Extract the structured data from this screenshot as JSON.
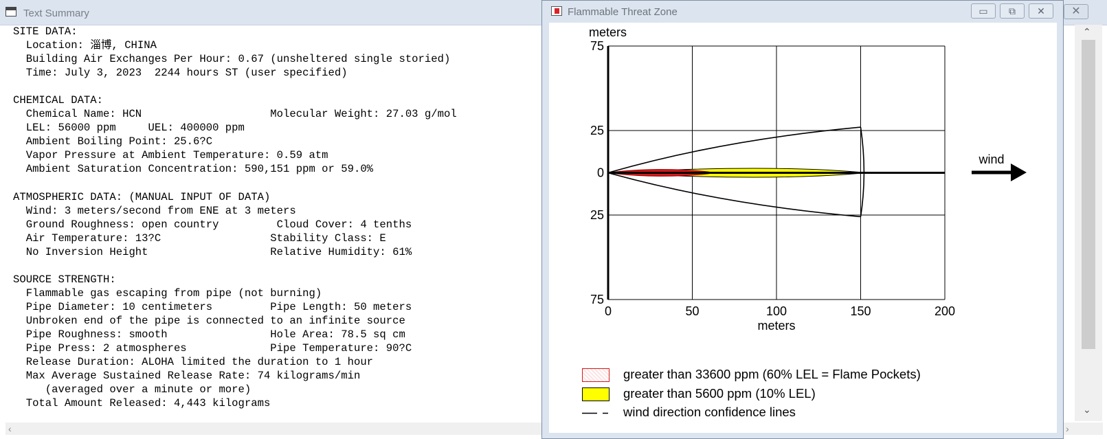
{
  "text_window": {
    "title": "Text Summary",
    "close_glyph": "✕",
    "lines": [
      "SITE DATA:",
      "  Location: 淄博, CHINA",
      "  Building Air Exchanges Per Hour: 0.67 (unsheltered single storied)",
      "  Time: July 3, 2023  2244 hours ST (user specified)",
      "",
      "CHEMICAL DATA:",
      "  Chemical Name: HCN                    Molecular Weight: 27.03 g/mol",
      "  LEL: 56000 ppm     UEL: 400000 ppm",
      "  Ambient Boiling Point: 25.6?C",
      "  Vapor Pressure at Ambient Temperature: 0.59 atm",
      "  Ambient Saturation Concentration: 590,151 ppm or 59.0%",
      "",
      "ATMOSPHERIC DATA: (MANUAL INPUT OF DATA)",
      "  Wind: 3 meters/second from ENE at 3 meters",
      "  Ground Roughness: open country         Cloud Cover: 4 tenths",
      "  Air Temperature: 13?C                 Stability Class: E",
      "  No Inversion Height                   Relative Humidity: 61%",
      "",
      "SOURCE STRENGTH:",
      "  Flammable gas escaping from pipe (not burning)",
      "  Pipe Diameter: 10 centimeters         Pipe Length: 50 meters",
      "  Unbroken end of the pipe is connected to an infinite source",
      "  Pipe Roughness: smooth                Hole Area: 78.5 sq cm",
      "  Pipe Press: 2 atmospheres             Pipe Temperature: 90?C",
      "  Release Duration: ALOHA limited the duration to 1 hour",
      "  Max Average Sustained Release Rate: 74 kilograms/min",
      "     (averaged over a minute or more)",
      "  Total Amount Released: 4,443 kilograms"
    ]
  },
  "threat_window": {
    "title": "Flammable Threat Zone",
    "buttons": {
      "minimize": "▭",
      "maximize": "⧉",
      "close": "✕"
    },
    "wind_label": "wind",
    "legend": [
      {
        "label": "greater than 33600 ppm (60% LEL = Flame Pockets)",
        "color": "#d61a1a"
      },
      {
        "label": "greater than 5600 ppm (10% LEL)",
        "color": "#ffff00"
      },
      {
        "label": "wind direction confidence lines",
        "color": "#000000"
      }
    ]
  },
  "chart_data": {
    "type": "area",
    "ylabel": "meters",
    "xlabel": "meters",
    "xlim": [
      0,
      200
    ],
    "ylim": [
      -75,
      75
    ],
    "x_ticks": [
      "0",
      "50",
      "100",
      "150",
      "200"
    ],
    "y_ticks": [
      "75",
      "25",
      "0",
      "25",
      "75"
    ],
    "grid": true,
    "zones": [
      {
        "name": "red",
        "color": "#d61a1a",
        "x": [
          0,
          60
        ],
        "half_width": [
          0,
          2.5,
          2.6,
          0.5
        ]
      },
      {
        "name": "yellow",
        "color": "#ffff00",
        "x": [
          0,
          153
        ],
        "half_width": [
          0,
          2.5,
          4.3,
          0
        ]
      },
      {
        "name": "confidence_lines",
        "x": [
          0,
          150
        ],
        "lateral_extent": [
          -26,
          27
        ]
      }
    ]
  }
}
